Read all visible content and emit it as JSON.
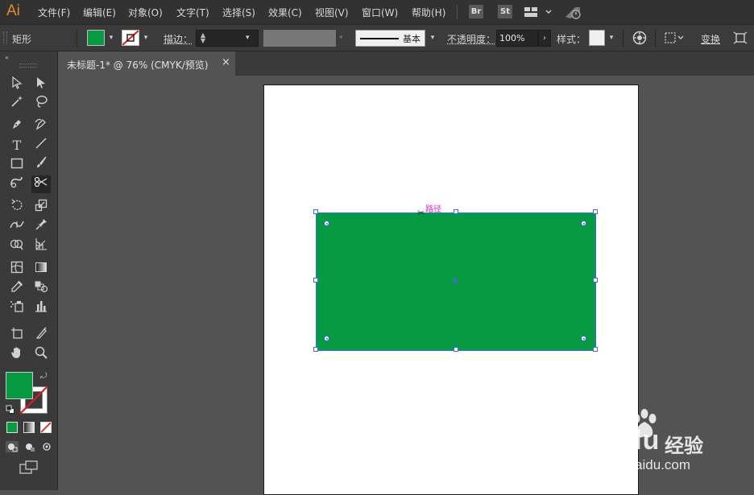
{
  "menubar": {
    "logo": "Ai",
    "items": [
      "文件(F)",
      "编辑(E)",
      "对象(O)",
      "文字(T)",
      "选择(S)",
      "效果(C)",
      "视图(V)",
      "窗口(W)",
      "帮助(H)"
    ],
    "bridge": "Br",
    "stock": "St"
  },
  "controlbar": {
    "object_type": "矩形",
    "stroke_label": "描边：",
    "brush_label": "基本",
    "opacity_label": "不透明度：",
    "opacity_value": "100%",
    "style_label": "样式：",
    "transform_label": "变换",
    "fill_color": "#079a42"
  },
  "document": {
    "tab_title": "未标题-1* @ 76% (CMYK/预览)",
    "close": "×"
  },
  "canvas": {
    "path_label": "路径",
    "shape_color": "#079a42"
  },
  "toolbar": {
    "fill_color": "#079a42",
    "stroke_color": "none"
  },
  "watermark": {
    "brand": "Baidu",
    "product": "经验",
    "url": "jingyan.baidu.com"
  }
}
